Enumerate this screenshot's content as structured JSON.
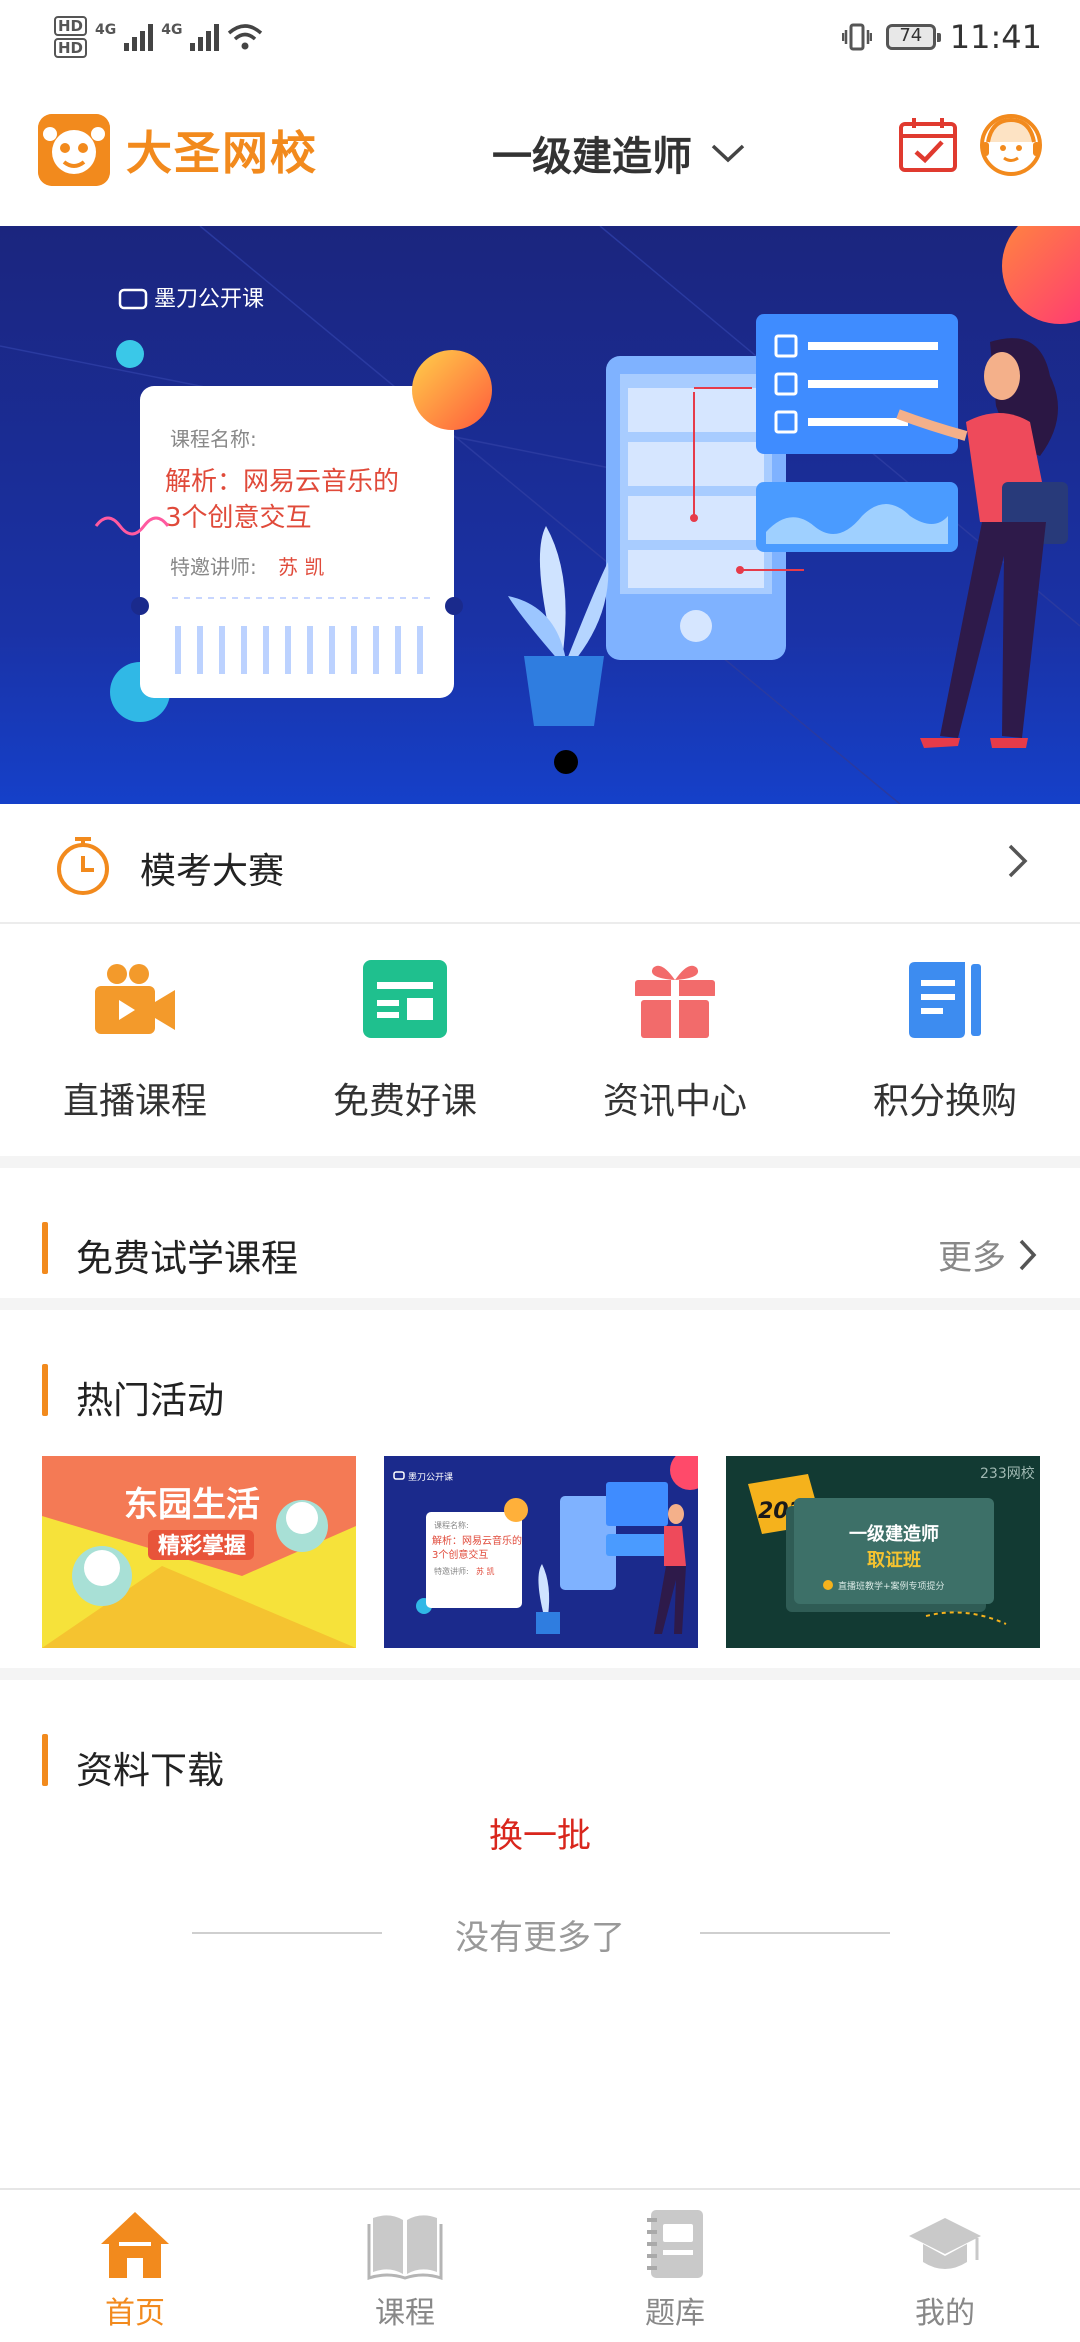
{
  "status_bar": {
    "sim1_badge": "HD",
    "sim2_badge": "HD",
    "network1": "4G",
    "network2": "4G",
    "battery": "74",
    "time": "11:41"
  },
  "header": {
    "logo_text": "大圣网校",
    "exam_selector": "一级建造师"
  },
  "banner": {
    "channel": "墨刀公开课",
    "course_label": "课程名称:",
    "course_title_line1": "解析：网易云音乐的",
    "course_title_line2": "3个创意交互",
    "lecturer_label": "特邀讲师:",
    "lecturer_name": "苏 凯",
    "page_count": 1,
    "active_page": 0
  },
  "mock_exam": {
    "label": "模考大赛"
  },
  "quick_nav": [
    {
      "label": "直播课程",
      "icon": "video-camera-icon",
      "color": "#f39a2b"
    },
    {
      "label": "免费好课",
      "icon": "free-course-icon",
      "color": "#1fc08e"
    },
    {
      "label": "资讯中心",
      "icon": "gift-icon",
      "color": "#f26b6b"
    },
    {
      "label": "积分换购",
      "icon": "document-list-icon",
      "color": "#3d8cf0"
    }
  ],
  "free_trial": {
    "title": "免费试学课程",
    "more": "更多"
  },
  "hot_activities": {
    "title": "热门活动",
    "cards": [
      {
        "title": "东园生活",
        "subtitle": "精彩掌握"
      },
      {
        "channel": "墨刀公开课",
        "course_label": "课程名称:",
        "title_line1": "解析：网易云音乐的",
        "title_line2": "3个创意交互",
        "lecturer_label": "特邀讲师:",
        "lecturer_name": "苏 凯"
      },
      {
        "year": "2020",
        "brand": "233网校",
        "title": "一级建造师",
        "subtitle": "取证班",
        "note": "直播班教学+案例专项提分"
      }
    ]
  },
  "downloads": {
    "title": "资料下载",
    "refresh": "换一批",
    "no_more": "没有更多了"
  },
  "tab_bar": [
    {
      "label": "首页",
      "icon": "home-icon",
      "active": true
    },
    {
      "label": "课程",
      "icon": "book-icon",
      "active": false
    },
    {
      "label": "题库",
      "icon": "question-bank-icon",
      "active": false
    },
    {
      "label": "我的",
      "icon": "graduation-cap-icon",
      "active": false
    }
  ],
  "colors": {
    "accent": "#f28a1d",
    "banner_bg": "#1a2a8c",
    "refresh": "#d9261c"
  }
}
